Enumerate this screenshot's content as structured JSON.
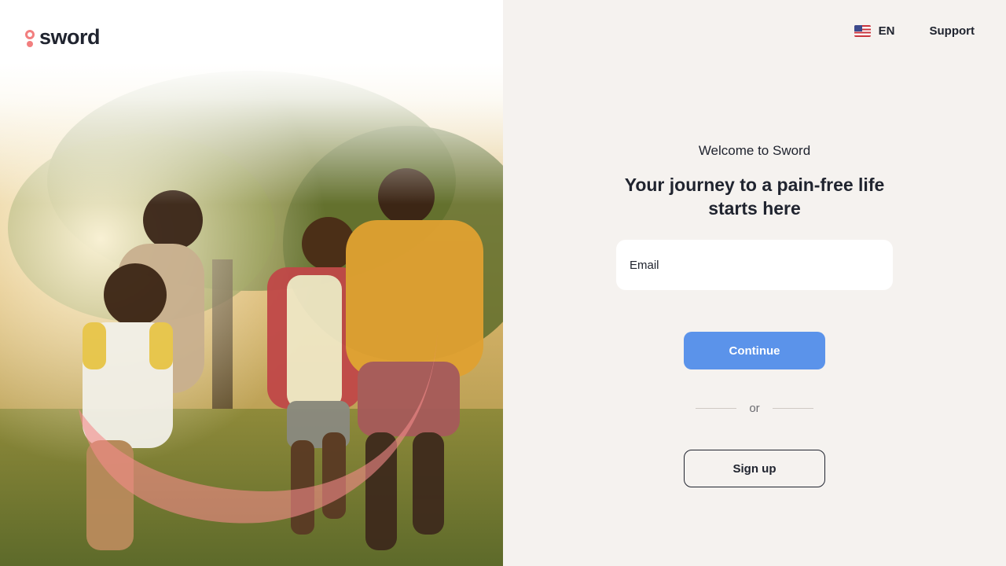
{
  "brand": {
    "name": "sword",
    "accent": "#f27f7f"
  },
  "header": {
    "language": {
      "code": "EN",
      "flag_icon": "us-flag-icon"
    },
    "support_label": "Support"
  },
  "form": {
    "welcome": "Welcome to Sword",
    "headline": "Your journey to a pain-free life starts here",
    "email_placeholder": "Email",
    "continue_label": "Continue",
    "divider_label": "or",
    "signup_label": "Sign up"
  },
  "colors": {
    "primary_button": "#5b93ea",
    "panel_background": "#f5f2ef",
    "text": "#20242f"
  }
}
